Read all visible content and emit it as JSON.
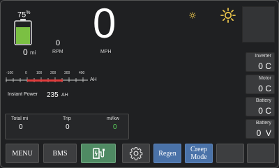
{
  "battery": {
    "percent": "75",
    "percent_symbol": "%",
    "level": 0.75,
    "fill_color": "#7bc043",
    "range_value": "0",
    "range_unit": "mi"
  },
  "rpm": {
    "value": "0",
    "unit": "RPM"
  },
  "speed": {
    "value": "0",
    "unit": "MPH"
  },
  "brightness": {
    "icons": [
      "brightness-low-icon",
      "brightness-high-icon"
    ]
  },
  "power_scale": {
    "ticks": [
      "-100",
      "0",
      "100",
      "200",
      "300",
      "400"
    ],
    "unit": "AH",
    "active_color": "#e23b3b"
  },
  "instant_power": {
    "label": "Instant Power",
    "value": "235",
    "unit": "AH"
  },
  "stats": {
    "total_label": "Total mi",
    "total_value": "0",
    "trip_label": "Trip",
    "trip_value": "0",
    "efficiency_label": "mi/kw",
    "efficiency_value": "0",
    "efficiency_color": "#5cd65c"
  },
  "temps": [
    {
      "label": "Inverter",
      "value": "0",
      "unit": "C"
    },
    {
      "label": "Motor",
      "value": "0",
      "unit": "C"
    },
    {
      "label": "Battery",
      "value": "0",
      "unit": "C"
    }
  ],
  "voltage": {
    "label": "Battery",
    "value": "0",
    "unit": "V"
  },
  "buttons": {
    "menu": "MENU",
    "bms": "BMS",
    "charge_icon": "charging-station-icon",
    "settings_icon": "gear-icon",
    "regen": "Regen",
    "creep_line1": "Creep",
    "creep_line2": "Mode"
  },
  "colors": {
    "background": "#1f2022",
    "button_blue": "#4a72a8",
    "button_green": "#4f8a63"
  }
}
